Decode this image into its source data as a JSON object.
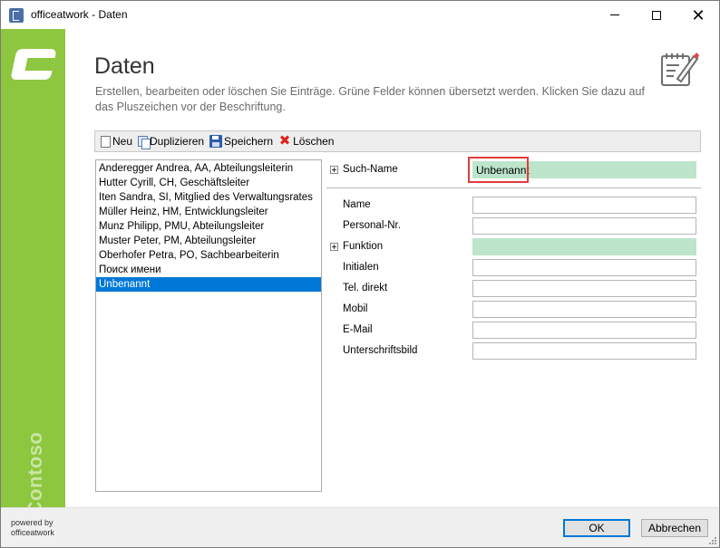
{
  "window": {
    "title": "officeatwork - Daten",
    "minimize_label": "",
    "maximize_label": "",
    "close_label": "✕"
  },
  "brand": {
    "vertical_text": "Contoso",
    "color": "#8dc63f"
  },
  "header": {
    "title": "Daten",
    "description": "Erstellen, bearbeiten oder löschen Sie Einträge. Grüne Felder können übersetzt werden. Klicken Sie dazu auf das Pluszeichen vor der Beschriftung."
  },
  "toolbar": {
    "new_label": "Neu",
    "duplicate_label": "Duplizieren",
    "save_label": "Speichern",
    "delete_label": "Löschen"
  },
  "list": {
    "items": [
      "Anderegger Andrea, AA, Abteilungsleiterin",
      "Hutter Cyrill, CH, Geschäftsleiter",
      "Iten Sandra, SI, Mitglied des Verwaltungsrates",
      "Müller Heinz, HM, Entwicklungsleiter",
      "Munz Philipp, PMU, Abteilungsleiter",
      "Muster Peter, PM, Abteilungsleiter",
      "Oberhofer Petra, PO, Sachbearbeiterin",
      "Поиск имени",
      "Unbenannt"
    ],
    "selected_index": 8
  },
  "form": {
    "such_name_label": "Such-Name",
    "such_name_value": "Unbenannt",
    "name_label": "Name",
    "name_value": "",
    "personal_nr_label": "Personal-Nr.",
    "personal_nr_value": "",
    "funktion_label": "Funktion",
    "funktion_value": "",
    "initialen_label": "Initialen",
    "initialen_value": "",
    "tel_label": "Tel. direkt",
    "tel_value": "",
    "mobil_label": "Mobil",
    "mobil_value": "",
    "email_label": "E-Mail",
    "email_value": "",
    "unterschrift_label": "Unterschriftsbild",
    "unterschrift_value": "",
    "translatable_color": "#bde5cb",
    "highlight_color": "#e03c3c"
  },
  "footer": {
    "powered_line1": "powered by",
    "powered_line2": "officeatwork",
    "ok_label": "OK",
    "cancel_label": "Abbrechen"
  }
}
